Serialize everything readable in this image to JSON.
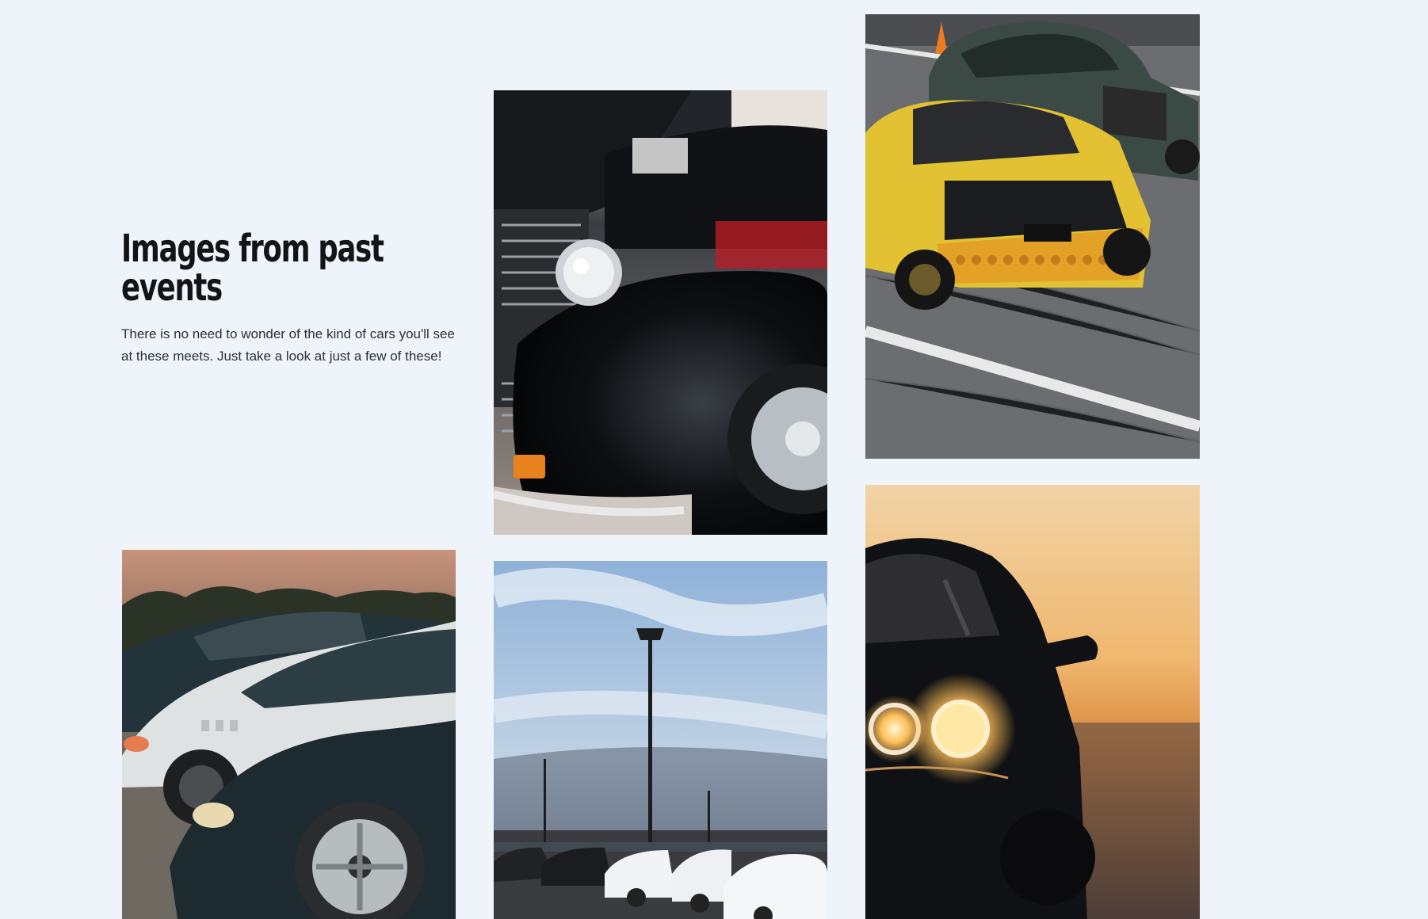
{
  "section": {
    "heading": "Images from past events",
    "description": "There is no need to wonder of the kind of cars you'll see at these meets. Just take a look at just a few of these!"
  },
  "gallery": {
    "photos": [
      {
        "subject": "black vintage car with chrome headlight"
      },
      {
        "subject": "drift cars racing on track"
      },
      {
        "subject": "parked cars at sunset"
      },
      {
        "subject": "car meet parking lot under cloudy sky"
      },
      {
        "subject": "black muscle car with glowing headlights at sunset"
      }
    ]
  },
  "colors": {
    "background": "#eef4fa",
    "heading": "#121417",
    "body_text": "#2c3035"
  }
}
